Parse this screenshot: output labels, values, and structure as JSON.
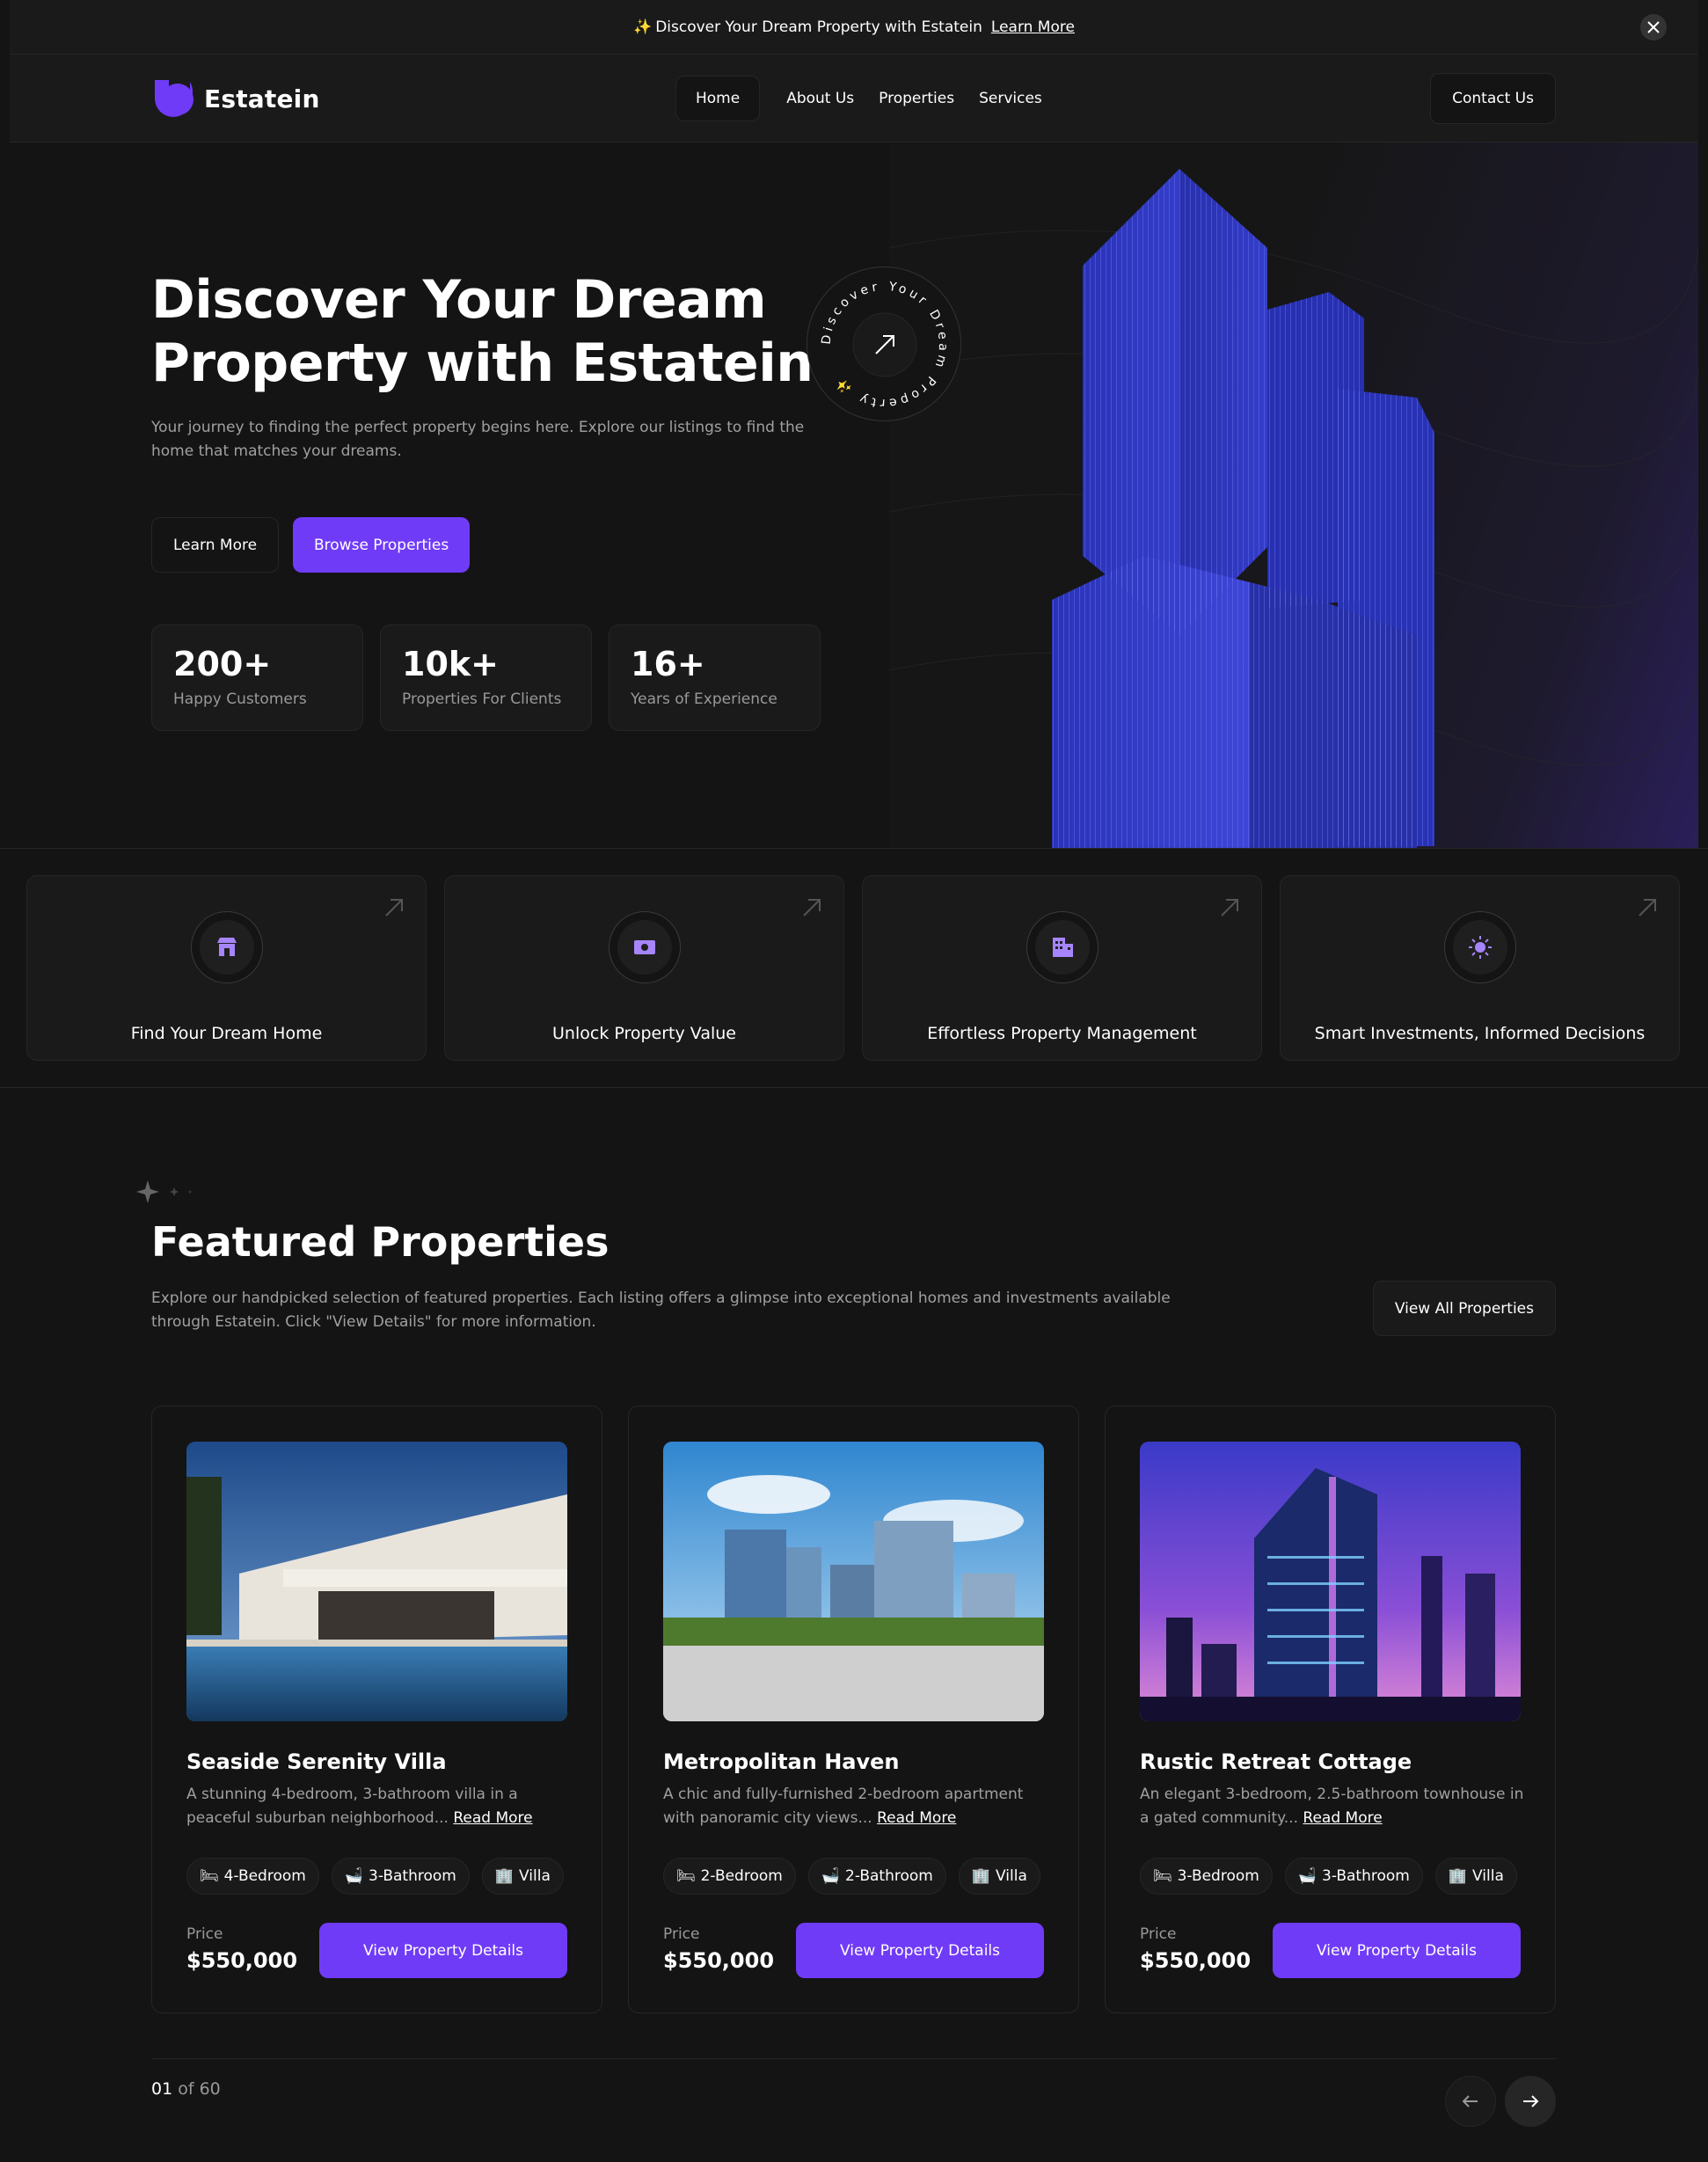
{
  "banner": {
    "text": "Discover Your Dream Property with Estatein",
    "link": "Learn More"
  },
  "nav": {
    "brand": "Estatein",
    "items": [
      "Home",
      "About Us",
      "Properties",
      "Services"
    ],
    "contact": "Contact Us"
  },
  "hero": {
    "title_line1": "Discover Your Dream",
    "title_line2": "Property with Estatein",
    "subtitle": "Your journey to finding the perfect property begins here. Explore our listings to find the home that matches your dreams.",
    "btn_learn": "Learn More",
    "btn_browse": "Browse Properties",
    "badge_text": "Discover Your Dream Property ✨",
    "stats": [
      {
        "num": "200+",
        "label": "Happy Customers"
      },
      {
        "num": "10k+",
        "label": "Properties For Clients"
      },
      {
        "num": "16+",
        "label": "Years of Experience"
      }
    ]
  },
  "features": [
    {
      "label": "Find Your Dream Home",
      "icon": "home-icon"
    },
    {
      "label": "Unlock Property Value",
      "icon": "money-icon"
    },
    {
      "label": "Effortless Property Management",
      "icon": "building-icon"
    },
    {
      "label": "Smart Investments, Informed Decisions",
      "icon": "sun-icon"
    }
  ],
  "featured": {
    "title": "Featured Properties",
    "subtitle": "Explore our handpicked selection of featured properties. Each listing offers a glimpse into exceptional homes and investments available through Estatein. Click \"View Details\" for more information.",
    "view_all": "View All Properties",
    "price_label": "Price",
    "view_details": "View Property Details",
    "read_more": "Read More",
    "properties": [
      {
        "name": "Seaside Serenity Villa",
        "desc": "A stunning 4-bedroom, 3-bathroom villa in a peaceful suburban neighborhood...",
        "bed": "4-Bedroom",
        "bath": "3-Bathroom",
        "type": "Villa",
        "price": "$550,000"
      },
      {
        "name": "Metropolitan Haven",
        "desc": "A chic and fully-furnished 2-bedroom apartment with panoramic city views...",
        "bed": "2-Bedroom",
        "bath": "2-Bathroom",
        "type": "Villa",
        "price": "$550,000"
      },
      {
        "name": "Rustic Retreat Cottage",
        "desc": "An elegant 3-bedroom, 2.5-bathroom townhouse in a gated community...",
        "bed": "3-Bedroom",
        "bath": "3-Bathroom",
        "type": "Villa",
        "price": "$550,000"
      }
    ],
    "pager_current": "01",
    "pager_total": " of 60"
  },
  "colors": {
    "accent": "#703bf7",
    "bg": "#141414",
    "card": "#1a1a1a",
    "border": "#262626"
  }
}
